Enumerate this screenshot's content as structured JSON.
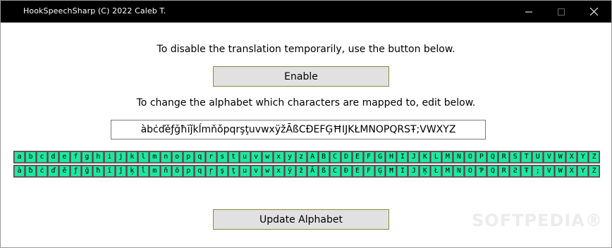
{
  "window": {
    "title": "HookSpeechSharp (C) 2022 Caleb T.",
    "controls": [
      "minimize-icon",
      "maximize-icon",
      "close-icon"
    ]
  },
  "main": {
    "disable_text": "To disable the translation temporarily, use the button below.",
    "enable_label": "Enable",
    "change_text": "To change the alphabet which characters are mapped to, edit below.",
    "alphabet_value": "àbċďěƒğħĭǰkĺmňǒpqrşţuvwxÿžĀßCÐEFĢĦIJKŁMNOPQRSŦ;VWXYZ",
    "update_label": "Update Alphabet"
  },
  "mapping": {
    "source": [
      "a",
      "b",
      "c",
      "d",
      "e",
      "f",
      "g",
      "h",
      "i",
      "j",
      "k",
      "l",
      "m",
      "n",
      "o",
      "p",
      "q",
      "r",
      "s",
      "t",
      "u",
      "v",
      "w",
      "x",
      "y",
      "z",
      "A",
      "B",
      "C",
      "D",
      "E",
      "F",
      "G",
      "H",
      "I",
      "J",
      "K",
      "L",
      "M",
      "N",
      "O",
      "P",
      "Q",
      "R",
      "S",
      "T",
      "U",
      "V",
      "W",
      "X",
      "Y",
      "Z"
    ],
    "target": [
      "à",
      "ƀ",
      "ċ",
      "ď",
      "ě",
      "ƒ",
      "ğ",
      "ħ",
      "ĭ",
      "ǰ",
      "ķ",
      "ĺ",
      "m",
      "ň",
      "ŏ",
      "p",
      "q",
      "ŗ",
      "ş",
      "ţ",
      "u",
      "v",
      "w",
      "x",
      "ÿ",
      "ž",
      "Ā",
      "ß",
      "C",
      "Ð",
      "E",
      "F",
      "Ģ",
      "Ħ",
      "I",
      "J",
      "Ķ",
      "Ł",
      "M",
      "N",
      "O",
      "Ƥ",
      "Q",
      "R",
      "Ƨ",
      "Ŧ",
      ";",
      "V",
      "W",
      "X",
      "Y",
      "Z"
    ]
  },
  "colors": {
    "cell_bg": "#1ee8a0",
    "titlebar_bg": "#000000",
    "button_bg": "#e1e1e1"
  },
  "watermark": "SOFTPEDIA®"
}
